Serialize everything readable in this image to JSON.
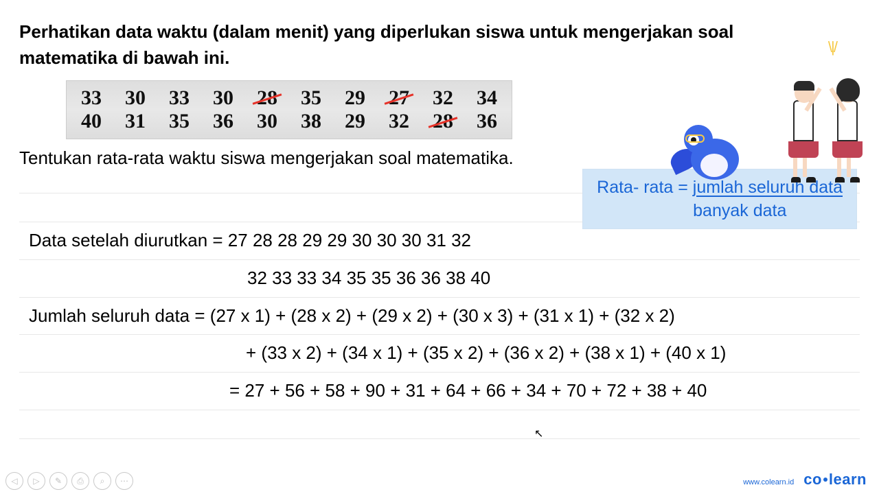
{
  "heading": "Perhatikan data waktu (dalam menit) yang diperlukan siswa untuk mengerjakan soal matematika di bawah ini.",
  "data_rows": {
    "r1": [
      "33",
      "30",
      "33",
      "30",
      "28",
      "35",
      "29",
      "27",
      "32",
      "34"
    ],
    "r2": [
      "40",
      "31",
      "35",
      "36",
      "30",
      "38",
      "29",
      "32",
      "28",
      "36"
    ]
  },
  "question": "Tentukan rata-rata waktu siswa mengerjakan soal matematika.",
  "formula": {
    "lhs": "Rata- rata = ",
    "numer": "jumlah seluruh data",
    "denom": "banyak data"
  },
  "work": {
    "sorted_label": "Data setelah diurutkan = ",
    "sorted_line1": "27  28  28  29  29  30  30  30  31  32",
    "sorted_line2": "32  33  33  34  35  35  36  36  38  40",
    "sum_label": "Jumlah seluruh data = ",
    "sum_line1": "(27 x 1) + (28 x 2) + (29 x 2) + (30 x 3) + (31 x 1) + (32 x 2)",
    "sum_line2": "+ (33 x 2) + (34 x 1) + (35 x 2) + (36 x 2) + (38 x 1) + (40 x 1)",
    "sum_line3": "= 27 + 56 + 58 + 90 + 31 + 64 + 66 + 34 + 70 + 72 + 38 + 40"
  },
  "icons": {
    "prev": "◁",
    "next": "▷",
    "pen": "✎",
    "pan": "⎙",
    "zoom": "⌕",
    "more": "⋯"
  },
  "footer": {
    "url": "www.colearn.id",
    "brand_a": "co",
    "brand_b": "learn"
  },
  "sparkle": "\\ | /"
}
